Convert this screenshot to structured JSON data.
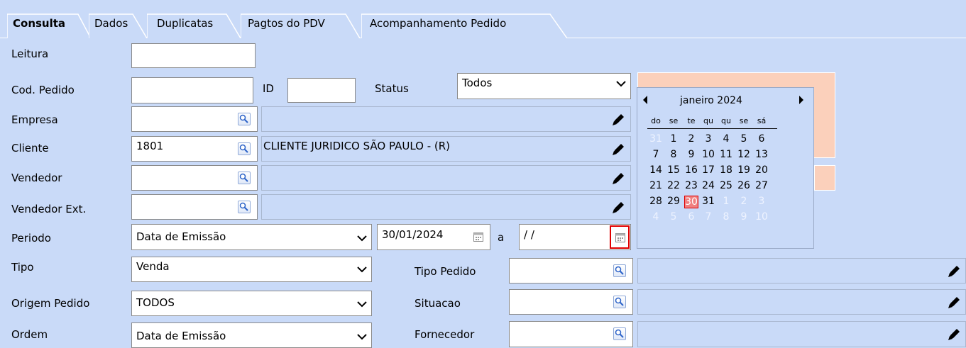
{
  "tabs": [
    {
      "label": "Consulta"
    },
    {
      "label": "Dados"
    },
    {
      "label": "Duplicatas"
    },
    {
      "label": "Pagtos do PDV"
    },
    {
      "label": "Acompanhamento Pedido"
    }
  ],
  "labels": {
    "leitura": "Leitura",
    "cod_pedido": "Cod. Pedido",
    "id": "ID",
    "status": "Status",
    "empresa": "Empresa",
    "cliente": "Cliente",
    "vendedor": "Vendedor",
    "vendedor_ext": "Vendedor Ext.",
    "periodo": "Periodo",
    "a": "a",
    "tipo": "Tipo",
    "tipo_pedido": "Tipo Pedido",
    "origem_pedido": "Origem Pedido",
    "situacao": "Situacao",
    "ordem": "Ordem",
    "fornecedor": "Fornecedor"
  },
  "fields": {
    "leitura": "",
    "cod_pedido": "",
    "id": "",
    "status": "Todos",
    "empresa_code": "",
    "empresa_desc": "",
    "cliente_code": "1801",
    "cliente_desc": "CLIENTE JURIDICO SÃO PAULO - (R)",
    "vendedor_code": "",
    "vendedor_desc": "",
    "vendedor_ext_code": "",
    "vendedor_ext_desc": "",
    "periodo": "Data de Emissão",
    "date_from": "30/01/2024",
    "date_to": " / /",
    "tipo": "Venda",
    "tipo_pedido_code": "",
    "tipo_pedido_desc": "",
    "origem_pedido": "TODOS",
    "situacao_code": "",
    "situacao_desc": "",
    "ordem": "Data de Emissão",
    "fornecedor_code": "",
    "fornecedor_desc": ""
  },
  "calendar": {
    "month_label": "janeiro 2024",
    "weekdays": [
      "do",
      "se",
      "te",
      "qu",
      "qu",
      "se",
      "sá"
    ],
    "weeks": [
      [
        "31",
        "1",
        "2",
        "3",
        "4",
        "5",
        "6"
      ],
      [
        "7",
        "8",
        "9",
        "10",
        "11",
        "12",
        "13"
      ],
      [
        "14",
        "15",
        "16",
        "17",
        "18",
        "19",
        "20"
      ],
      [
        "21",
        "22",
        "23",
        "24",
        "25",
        "26",
        "27"
      ],
      [
        "28",
        "29",
        "30",
        "31",
        "1",
        "2",
        "3"
      ],
      [
        "4",
        "5",
        "6",
        "7",
        "8",
        "9",
        "10"
      ]
    ],
    "selected_day": "30"
  },
  "colors": {
    "background": "#c9daf8",
    "peach": "#fbd0bb",
    "selected_day": "#f08080",
    "highlight_border": "#e00000"
  },
  "icons": {
    "lookup": "magnifier-icon",
    "edit": "pencil-icon",
    "calendar": "calendar-icon",
    "dropdown": "chevron-down-icon"
  }
}
